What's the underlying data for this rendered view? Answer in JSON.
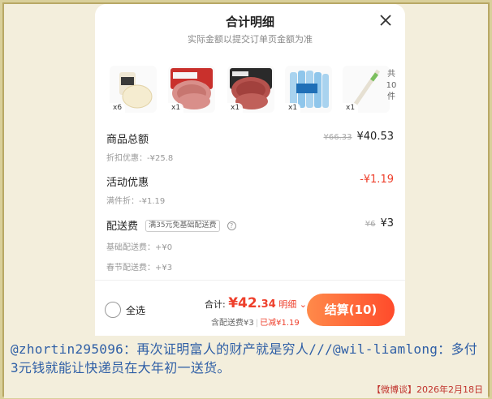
{
  "header": {
    "title": "合计明细",
    "subtitle": "实际金额以提交订单页金额为准"
  },
  "items": [
    {
      "name": "bread-product",
      "qty": "x6"
    },
    {
      "name": "pork-mince-product",
      "qty": "x1"
    },
    {
      "name": "beef-mince-product",
      "qty": "x1"
    },
    {
      "name": "water-bottles-product",
      "qty": "x1"
    },
    {
      "name": "straw-product",
      "qty": "x1"
    }
  ],
  "items_total_count": "共10件",
  "summary": {
    "goods": {
      "label": "商品总额",
      "original": "¥66.33",
      "value": "¥40.53",
      "discount_label": "折扣优惠：-¥25.8"
    },
    "promo": {
      "label": "活动优惠",
      "value": "-¥1.19",
      "detail": "满件折：-¥1.19"
    },
    "shipping": {
      "label": "配送费",
      "tag": "满35元免基础配送费",
      "original": "¥6",
      "value": "¥3",
      "base": "基础配送费：+¥0",
      "holiday": "春节配送费：+¥3"
    }
  },
  "footer": {
    "select_all": "全选",
    "total_prefix": "合计:",
    "total_yuan": "¥42",
    "total_cents": ".34",
    "detail_link": "明细",
    "sub_shipping": "含配送费¥3",
    "sub_saved": "已减¥1.19",
    "checkout": "结算(10)"
  },
  "caption": {
    "text": "@zhortin295096：再次证明富人的财产就是穷人///@wil-liamlong：多付3元钱就能让快递员在大年初一送货。",
    "date": "【微博谈】2026年2月18日"
  },
  "colors": {
    "accent": "#ee3f2b",
    "caption": "#2f5fa6",
    "background": "#f3eedc"
  }
}
